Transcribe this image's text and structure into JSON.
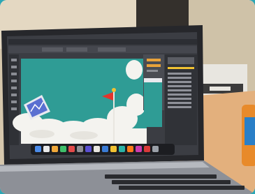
{
  "photo": {
    "subject": "laptop-running-illustration-app",
    "colors": {
      "frame": "#2aa7b6",
      "wall": "#d9cbb2",
      "laptop_body": "#2b2c30",
      "screen_dark": "#3a3c42",
      "canvas_teal": "#2c9d94",
      "clouds": "#f3f2ef",
      "flag_red": "#e2352c",
      "table": "#e7b583",
      "dock": "#1c1c20"
    },
    "elements": [
      "laptop",
      "illustration-canvas",
      "tools-panel",
      "layers-panel",
      "dock",
      "keyboard",
      "table",
      "drink-can",
      "paper-stack"
    ]
  }
}
